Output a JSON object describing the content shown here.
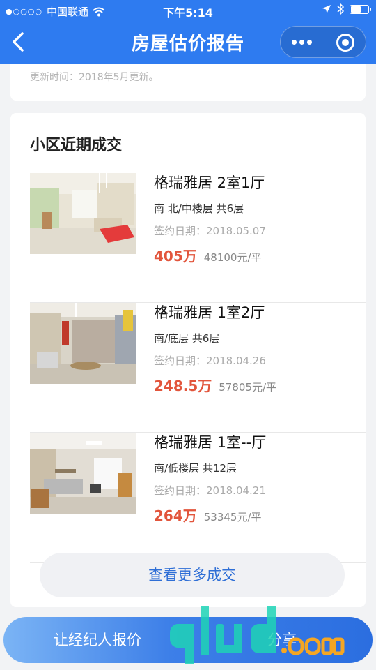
{
  "status_bar": {
    "signal": "●○○○○",
    "carrier": "中国联通",
    "time": "下午5:14"
  },
  "nav": {
    "title": "房屋估价报告",
    "icons": [
      "back-arrow-icon",
      "more-dots-icon",
      "close-target-icon"
    ]
  },
  "prev_card": {
    "update_text": "更新时间：2018年5月更新。"
  },
  "section": {
    "title": "小区近期成交"
  },
  "deals": [
    {
      "name": "格瑞雅居 2室1厅",
      "attrs": "南 北/中楼层 共6层",
      "date": "签约日期：2018.05.07",
      "price": "405万",
      "unit_price": "48100元/平"
    },
    {
      "name": "格瑞雅居 1室2厅",
      "attrs": "南/底层 共6层",
      "date": "签约日期：2018.04.26",
      "price": "248.5万",
      "unit_price": "57805元/平"
    },
    {
      "name": "格瑞雅居 1室--厅",
      "attrs": "南/低楼层 共12层",
      "date": "签约日期：2018.04.21",
      "price": "264万",
      "unit_price": "53345元/平"
    }
  ],
  "more_button": "查看更多成交",
  "bottom_bar": {
    "agent_label": "让经纪人报价",
    "share_label": "分享"
  },
  "colors": {
    "primary": "#2e7bf0",
    "price": "#e2553c",
    "link": "#2f6fd6"
  }
}
